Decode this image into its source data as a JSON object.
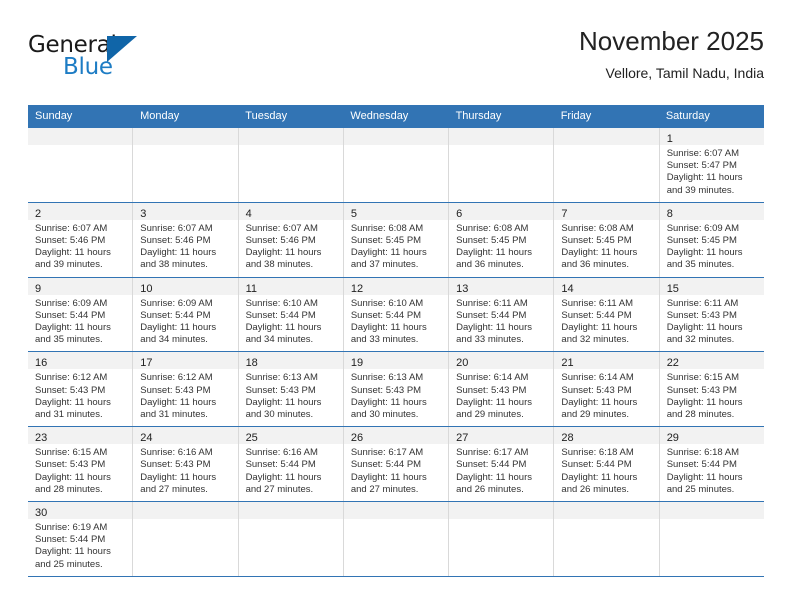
{
  "brand": {
    "name_part1": "General",
    "name_part2": "Blue",
    "accent_color": "#1065a8"
  },
  "header": {
    "title": "November 2025",
    "subtitle": "Vellore, Tamil Nadu, India"
  },
  "theme": {
    "header_blue": "#3274b4",
    "daynum_band": "#f2f2f2",
    "cell_border": "#d9d9d9"
  },
  "calendar": {
    "weekday_headers": [
      "Sunday",
      "Monday",
      "Tuesday",
      "Wednesday",
      "Thursday",
      "Friday",
      "Saturday"
    ],
    "weeks": [
      [
        {
          "day": "",
          "lines": []
        },
        {
          "day": "",
          "lines": []
        },
        {
          "day": "",
          "lines": []
        },
        {
          "day": "",
          "lines": []
        },
        {
          "day": "",
          "lines": []
        },
        {
          "day": "",
          "lines": []
        },
        {
          "day": "1",
          "lines": [
            "Sunrise: 6:07 AM",
            "Sunset: 5:47 PM",
            "Daylight: 11 hours",
            "and 39 minutes."
          ]
        }
      ],
      [
        {
          "day": "2",
          "lines": [
            "Sunrise: 6:07 AM",
            "Sunset: 5:46 PM",
            "Daylight: 11 hours",
            "and 39 minutes."
          ]
        },
        {
          "day": "3",
          "lines": [
            "Sunrise: 6:07 AM",
            "Sunset: 5:46 PM",
            "Daylight: 11 hours",
            "and 38 minutes."
          ]
        },
        {
          "day": "4",
          "lines": [
            "Sunrise: 6:07 AM",
            "Sunset: 5:46 PM",
            "Daylight: 11 hours",
            "and 38 minutes."
          ]
        },
        {
          "day": "5",
          "lines": [
            "Sunrise: 6:08 AM",
            "Sunset: 5:45 PM",
            "Daylight: 11 hours",
            "and 37 minutes."
          ]
        },
        {
          "day": "6",
          "lines": [
            "Sunrise: 6:08 AM",
            "Sunset: 5:45 PM",
            "Daylight: 11 hours",
            "and 36 minutes."
          ]
        },
        {
          "day": "7",
          "lines": [
            "Sunrise: 6:08 AM",
            "Sunset: 5:45 PM",
            "Daylight: 11 hours",
            "and 36 minutes."
          ]
        },
        {
          "day": "8",
          "lines": [
            "Sunrise: 6:09 AM",
            "Sunset: 5:45 PM",
            "Daylight: 11 hours",
            "and 35 minutes."
          ]
        }
      ],
      [
        {
          "day": "9",
          "lines": [
            "Sunrise: 6:09 AM",
            "Sunset: 5:44 PM",
            "Daylight: 11 hours",
            "and 35 minutes."
          ]
        },
        {
          "day": "10",
          "lines": [
            "Sunrise: 6:09 AM",
            "Sunset: 5:44 PM",
            "Daylight: 11 hours",
            "and 34 minutes."
          ]
        },
        {
          "day": "11",
          "lines": [
            "Sunrise: 6:10 AM",
            "Sunset: 5:44 PM",
            "Daylight: 11 hours",
            "and 34 minutes."
          ]
        },
        {
          "day": "12",
          "lines": [
            "Sunrise: 6:10 AM",
            "Sunset: 5:44 PM",
            "Daylight: 11 hours",
            "and 33 minutes."
          ]
        },
        {
          "day": "13",
          "lines": [
            "Sunrise: 6:11 AM",
            "Sunset: 5:44 PM",
            "Daylight: 11 hours",
            "and 33 minutes."
          ]
        },
        {
          "day": "14",
          "lines": [
            "Sunrise: 6:11 AM",
            "Sunset: 5:44 PM",
            "Daylight: 11 hours",
            "and 32 minutes."
          ]
        },
        {
          "day": "15",
          "lines": [
            "Sunrise: 6:11 AM",
            "Sunset: 5:43 PM",
            "Daylight: 11 hours",
            "and 32 minutes."
          ]
        }
      ],
      [
        {
          "day": "16",
          "lines": [
            "Sunrise: 6:12 AM",
            "Sunset: 5:43 PM",
            "Daylight: 11 hours",
            "and 31 minutes."
          ]
        },
        {
          "day": "17",
          "lines": [
            "Sunrise: 6:12 AM",
            "Sunset: 5:43 PM",
            "Daylight: 11 hours",
            "and 31 minutes."
          ]
        },
        {
          "day": "18",
          "lines": [
            "Sunrise: 6:13 AM",
            "Sunset: 5:43 PM",
            "Daylight: 11 hours",
            "and 30 minutes."
          ]
        },
        {
          "day": "19",
          "lines": [
            "Sunrise: 6:13 AM",
            "Sunset: 5:43 PM",
            "Daylight: 11 hours",
            "and 30 minutes."
          ]
        },
        {
          "day": "20",
          "lines": [
            "Sunrise: 6:14 AM",
            "Sunset: 5:43 PM",
            "Daylight: 11 hours",
            "and 29 minutes."
          ]
        },
        {
          "day": "21",
          "lines": [
            "Sunrise: 6:14 AM",
            "Sunset: 5:43 PM",
            "Daylight: 11 hours",
            "and 29 minutes."
          ]
        },
        {
          "day": "22",
          "lines": [
            "Sunrise: 6:15 AM",
            "Sunset: 5:43 PM",
            "Daylight: 11 hours",
            "and 28 minutes."
          ]
        }
      ],
      [
        {
          "day": "23",
          "lines": [
            "Sunrise: 6:15 AM",
            "Sunset: 5:43 PM",
            "Daylight: 11 hours",
            "and 28 minutes."
          ]
        },
        {
          "day": "24",
          "lines": [
            "Sunrise: 6:16 AM",
            "Sunset: 5:43 PM",
            "Daylight: 11 hours",
            "and 27 minutes."
          ]
        },
        {
          "day": "25",
          "lines": [
            "Sunrise: 6:16 AM",
            "Sunset: 5:44 PM",
            "Daylight: 11 hours",
            "and 27 minutes."
          ]
        },
        {
          "day": "26",
          "lines": [
            "Sunrise: 6:17 AM",
            "Sunset: 5:44 PM",
            "Daylight: 11 hours",
            "and 27 minutes."
          ]
        },
        {
          "day": "27",
          "lines": [
            "Sunrise: 6:17 AM",
            "Sunset: 5:44 PM",
            "Daylight: 11 hours",
            "and 26 minutes."
          ]
        },
        {
          "day": "28",
          "lines": [
            "Sunrise: 6:18 AM",
            "Sunset: 5:44 PM",
            "Daylight: 11 hours",
            "and 26 minutes."
          ]
        },
        {
          "day": "29",
          "lines": [
            "Sunrise: 6:18 AM",
            "Sunset: 5:44 PM",
            "Daylight: 11 hours",
            "and 25 minutes."
          ]
        }
      ],
      [
        {
          "day": "30",
          "lines": [
            "Sunrise: 6:19 AM",
            "Sunset: 5:44 PM",
            "Daylight: 11 hours",
            "and 25 minutes."
          ]
        },
        {
          "day": "",
          "lines": []
        },
        {
          "day": "",
          "lines": []
        },
        {
          "day": "",
          "lines": []
        },
        {
          "day": "",
          "lines": []
        },
        {
          "day": "",
          "lines": []
        },
        {
          "day": "",
          "lines": []
        }
      ]
    ]
  }
}
